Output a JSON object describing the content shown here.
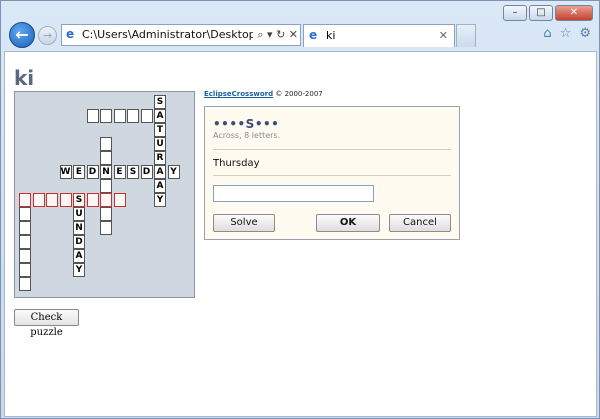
{
  "browser": {
    "address": "C:\\Users\\Administrator\\Desktop\\po.htr",
    "address_tools": "⌕ ▾ ↻ ✕",
    "tab_title": "ki",
    "tab_close": "✕",
    "window_controls": [
      "–",
      "□",
      "✕"
    ],
    "toolbar_icons": [
      "⌂",
      "☆",
      "⚙"
    ]
  },
  "page": {
    "title": "ki",
    "check_button": "Check puzzle",
    "credit_link": "EclipseCrossword",
    "credit_text": " © 2000-2007"
  },
  "clue_panel": {
    "pattern": "••••S•••",
    "meta": "Across, 8 letters.",
    "clue": "Thursday",
    "answer_value": "",
    "solve_label": "Solve",
    "ok_label": "OK",
    "cancel_label": "Cancel"
  },
  "colors": {
    "selected_border": "#c8302c",
    "grid_background": "#cfd8e0",
    "panel_background": "#fffbf0",
    "title_color": "#5a6880"
  },
  "puzzle": {
    "words": [
      {
        "answer": "SATURDAY",
        "direction": "down"
      },
      {
        "answer": "WEDNESDAY",
        "direction": "across"
      },
      {
        "answer": "SUNDAY",
        "direction": "down"
      },
      {
        "answer": "",
        "length": 8,
        "direction": "across",
        "selected": true
      },
      {
        "answer": "",
        "length": 6,
        "direction": "across"
      },
      {
        "answer": "",
        "length": 6,
        "direction": "down"
      },
      {
        "answer": "",
        "length": 7,
        "direction": "down"
      }
    ]
  }
}
